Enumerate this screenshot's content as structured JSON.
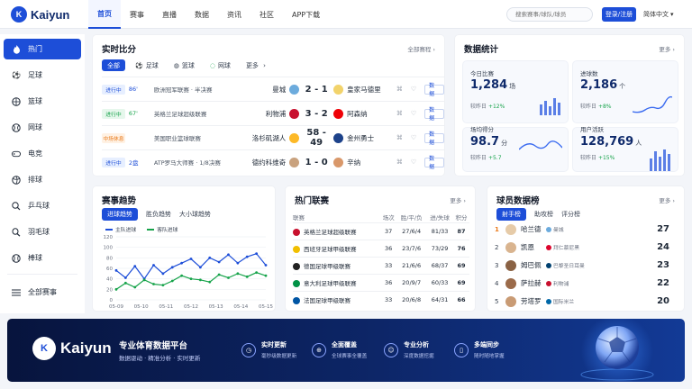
{
  "brand": {
    "logo_mark": "K",
    "name": "Kaiyun"
  },
  "nav": [
    "首页",
    "赛事",
    "直播",
    "数据",
    "资讯",
    "社区",
    "APP下载"
  ],
  "search": {
    "placeholder": "搜索赛事/球队/球员"
  },
  "header": {
    "login": "登录/注册",
    "language": "简体中文"
  },
  "sidebar": {
    "items": [
      {
        "label": "热门",
        "icon": "fire-icon"
      },
      {
        "label": "足球",
        "icon": "soccer-ball-icon"
      },
      {
        "label": "篮球",
        "icon": "basketball-icon"
      },
      {
        "label": "网球",
        "icon": "tennis-icon"
      },
      {
        "label": "电竞",
        "icon": "gamepad-icon"
      },
      {
        "label": "排球",
        "icon": "volleyball-icon"
      },
      {
        "label": "乒乓球",
        "icon": "pingpong-icon"
      },
      {
        "label": "羽毛球",
        "icon": "badminton-icon"
      },
      {
        "label": "棒球",
        "icon": "baseball-icon"
      }
    ],
    "all_events": "全部赛事"
  },
  "live": {
    "title": "实时比分",
    "more": "全部赛程",
    "filters": [
      "全部",
      "足球",
      "篮球",
      "网球",
      "更多"
    ],
    "matches": [
      {
        "status": "进行中",
        "minute": "86'",
        "league": "欧洲冠军联赛 · 半决赛",
        "home": "曼城",
        "score": "2 - 1",
        "away": "皇家马德里",
        "btn": "数据"
      },
      {
        "status": "进行中",
        "minute": "67'",
        "league": "英格兰足球超级联赛",
        "home": "利物浦",
        "score": "3 - 2",
        "away": "阿森纳",
        "btn": "数据"
      },
      {
        "status": "中场休息",
        "minute": "",
        "league": "美国职业篮球联赛",
        "home": "洛杉矶湖人",
        "score": "58 - 49",
        "away": "金州勇士",
        "btn": "数据"
      },
      {
        "status": "进行中",
        "minute": "2盘",
        "league": "ATP罗马大师赛 · 1/8决赛",
        "home": "德约科维奇",
        "score": "1 - 0",
        "away": "辛纳",
        "btn": "数据"
      }
    ]
  },
  "stats": {
    "title": "数据统计",
    "more": "更多",
    "cards": [
      {
        "label": "今日比赛",
        "value": "1,284",
        "unit": "场",
        "compare": "较昨日",
        "delta": "+12%"
      },
      {
        "label": "进球数",
        "value": "2,186",
        "unit": "个",
        "compare": "较昨日",
        "delta": "+8%"
      },
      {
        "label": "场均得分",
        "value": "98.7",
        "unit": "分",
        "compare": "较昨日",
        "delta": "+5.7"
      },
      {
        "label": "用户活跃",
        "value": "128,769",
        "unit": "人",
        "compare": "较昨日",
        "delta": "+15%"
      }
    ]
  },
  "trend": {
    "title": "赛事趋势",
    "tabs": [
      "进球趋势",
      "胜负趋势",
      "大小球趋势"
    ],
    "chart_data": {
      "type": "line",
      "x": [
        "05-09",
        "05-10",
        "05-11",
        "05-12",
        "05-13",
        "05-14",
        "05-15"
      ],
      "ylim": [
        0,
        120
      ],
      "yticks": [
        0,
        20,
        40,
        60,
        80,
        100,
        120
      ],
      "series": [
        {
          "name": "主队进球",
          "color": "#1d4ed8",
          "values": [
            56,
            42,
            64,
            40,
            66,
            50,
            62,
            70,
            78,
            62,
            80,
            72,
            86,
            70,
            82,
            88,
            66
          ]
        },
        {
          "name": "客队进球",
          "color": "#16a34a",
          "values": [
            20,
            32,
            24,
            38,
            30,
            28,
            36,
            46,
            40,
            38,
            34,
            48,
            42,
            50,
            44,
            52,
            46
          ]
        }
      ]
    }
  },
  "league": {
    "title": "热门联赛",
    "more": "更多",
    "headers": [
      "联赛",
      "场次",
      "胜/平/负",
      "进/失球",
      "积分"
    ],
    "rows": [
      {
        "name": "英格兰足球超级联赛",
        "played": "37",
        "wdl": "27/6/4",
        "gfga": "81/33",
        "pts": "87",
        "flag": "#c8102e"
      },
      {
        "name": "西班牙足球甲级联赛",
        "played": "36",
        "wdl": "23/7/6",
        "gfga": "73/29",
        "pts": "76",
        "flag": "#f1bf00"
      },
      {
        "name": "德国足球甲级联赛",
        "played": "33",
        "wdl": "21/6/6",
        "gfga": "68/37",
        "pts": "69",
        "flag": "#222222"
      },
      {
        "name": "意大利足球甲级联赛",
        "played": "36",
        "wdl": "20/9/7",
        "gfga": "60/33",
        "pts": "69",
        "flag": "#009246"
      },
      {
        "name": "法国足球甲级联赛",
        "played": "33",
        "wdl": "20/6/8",
        "gfga": "64/31",
        "pts": "66",
        "flag": "#0055a4"
      }
    ]
  },
  "players": {
    "title": "球员数据榜",
    "more": "更多",
    "tabs": [
      "射手榜",
      "助攻榜",
      "评分榜"
    ],
    "rows": [
      {
        "rank": "1",
        "name": "哈兰德",
        "club": "曼城",
        "goals": "27"
      },
      {
        "rank": "2",
        "name": "凯恩",
        "club": "拜仁慕尼黑",
        "goals": "24"
      },
      {
        "rank": "3",
        "name": "姆巴佩",
        "club": "巴黎圣日耳曼",
        "goals": "23"
      },
      {
        "rank": "4",
        "name": "萨拉赫",
        "club": "利物浦",
        "goals": "22"
      },
      {
        "rank": "5",
        "name": "劳塔罗",
        "club": "国际米兰",
        "goals": "20"
      }
    ]
  },
  "banner": {
    "brand": "Kaiyun",
    "title": "专业体育数据平台",
    "subtitle": "数据驱动 · 精准分析 · 实时更新",
    "features": [
      {
        "title": "实时更新",
        "sub": "毫秒级数据更新",
        "icon": "clock-icon"
      },
      {
        "title": "全面覆盖",
        "sub": "全球赛事全覆盖",
        "icon": "globe-icon"
      },
      {
        "title": "专业分析",
        "sub": "深度数据挖掘",
        "icon": "analyst-icon"
      },
      {
        "title": "多端同步",
        "sub": "随时随地掌握",
        "icon": "phone-icon"
      }
    ]
  }
}
